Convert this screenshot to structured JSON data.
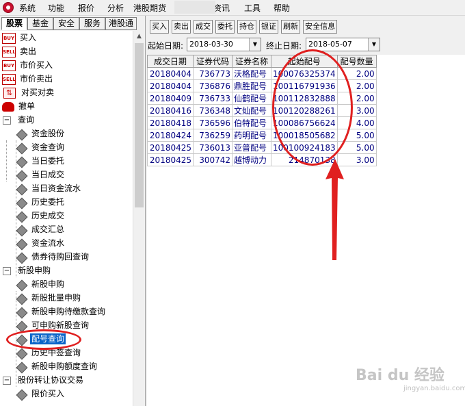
{
  "menubar": {
    "items": [
      {
        "label": "系统"
      },
      {
        "label": "功能"
      },
      {
        "label": "报价"
      },
      {
        "label": "分析"
      },
      {
        "label": "港股期货"
      },
      {
        "label": "资讯"
      },
      {
        "label": "工具"
      },
      {
        "label": "帮助"
      }
    ]
  },
  "tabs": [
    {
      "label": "股票",
      "active": true
    },
    {
      "label": "基金"
    },
    {
      "label": "安全"
    },
    {
      "label": "服务"
    },
    {
      "label": "港股通"
    }
  ],
  "tree": {
    "buy": "买入",
    "sell": "卖出",
    "market_buy": "市价买入",
    "market_sell": "市价卖出",
    "swap_buy_sell": "对买对卖",
    "cancel_order": "撤单",
    "query": "查询",
    "query_items": [
      "资金股份",
      "资金查询",
      "当日委托",
      "当日成交",
      "当日资金流水",
      "历史委托",
      "历史成交",
      "成交汇总",
      "资金流水",
      "债券待购回查询"
    ],
    "ipo": "新股申购",
    "ipo_items": [
      "新股申购",
      "新股批量申购",
      "新股申购待缴款查询",
      "可申购新股查询",
      "配号查询",
      "历史中签查询",
      "新股申购额度查询"
    ],
    "transfer": "股份转让协议交易",
    "transfer_items": [
      "限价买入"
    ],
    "badge_buy": "BUY",
    "badge_sell": "SELL"
  },
  "toolbar": {
    "buttons": [
      "买入",
      "卖出",
      "成交",
      "委托",
      "持仓",
      "银证",
      "刷新",
      "安全信息"
    ]
  },
  "filter": {
    "start_label": "起始日期:",
    "start_value": "2018-03-30",
    "end_label": "终止日期:",
    "end_value": "2018-05-07"
  },
  "grid": {
    "headers": [
      "成交日期",
      "证券代码",
      "证券名称",
      "起始配号",
      "配号数量"
    ],
    "rows": [
      [
        "20180404",
        "736773",
        "沃格配号",
        "100076325374",
        "2.00"
      ],
      [
        "20180404",
        "736876",
        "鼎胜配号",
        "100116791936",
        "2.00"
      ],
      [
        "20180409",
        "736733",
        "仙鹤配号",
        "100112832888",
        "2.00"
      ],
      [
        "20180416",
        "736348",
        "文灿配号",
        "100120288261",
        "3.00"
      ],
      [
        "20180418",
        "736596",
        "伯特配号",
        "100086756624",
        "4.00"
      ],
      [
        "20180424",
        "736259",
        "药明配号",
        "100018505682",
        "5.00"
      ],
      [
        "20180425",
        "736013",
        "亚普配号",
        "100100924183",
        "5.00"
      ],
      [
        "20180425",
        "300742",
        "越博动力",
        "214870138",
        "3.00"
      ]
    ]
  },
  "annotation": {
    "arrow_color": "#e02020"
  },
  "watermark": {
    "brand": "Bai du 经验",
    "url": "jingyan.baidu.com"
  }
}
